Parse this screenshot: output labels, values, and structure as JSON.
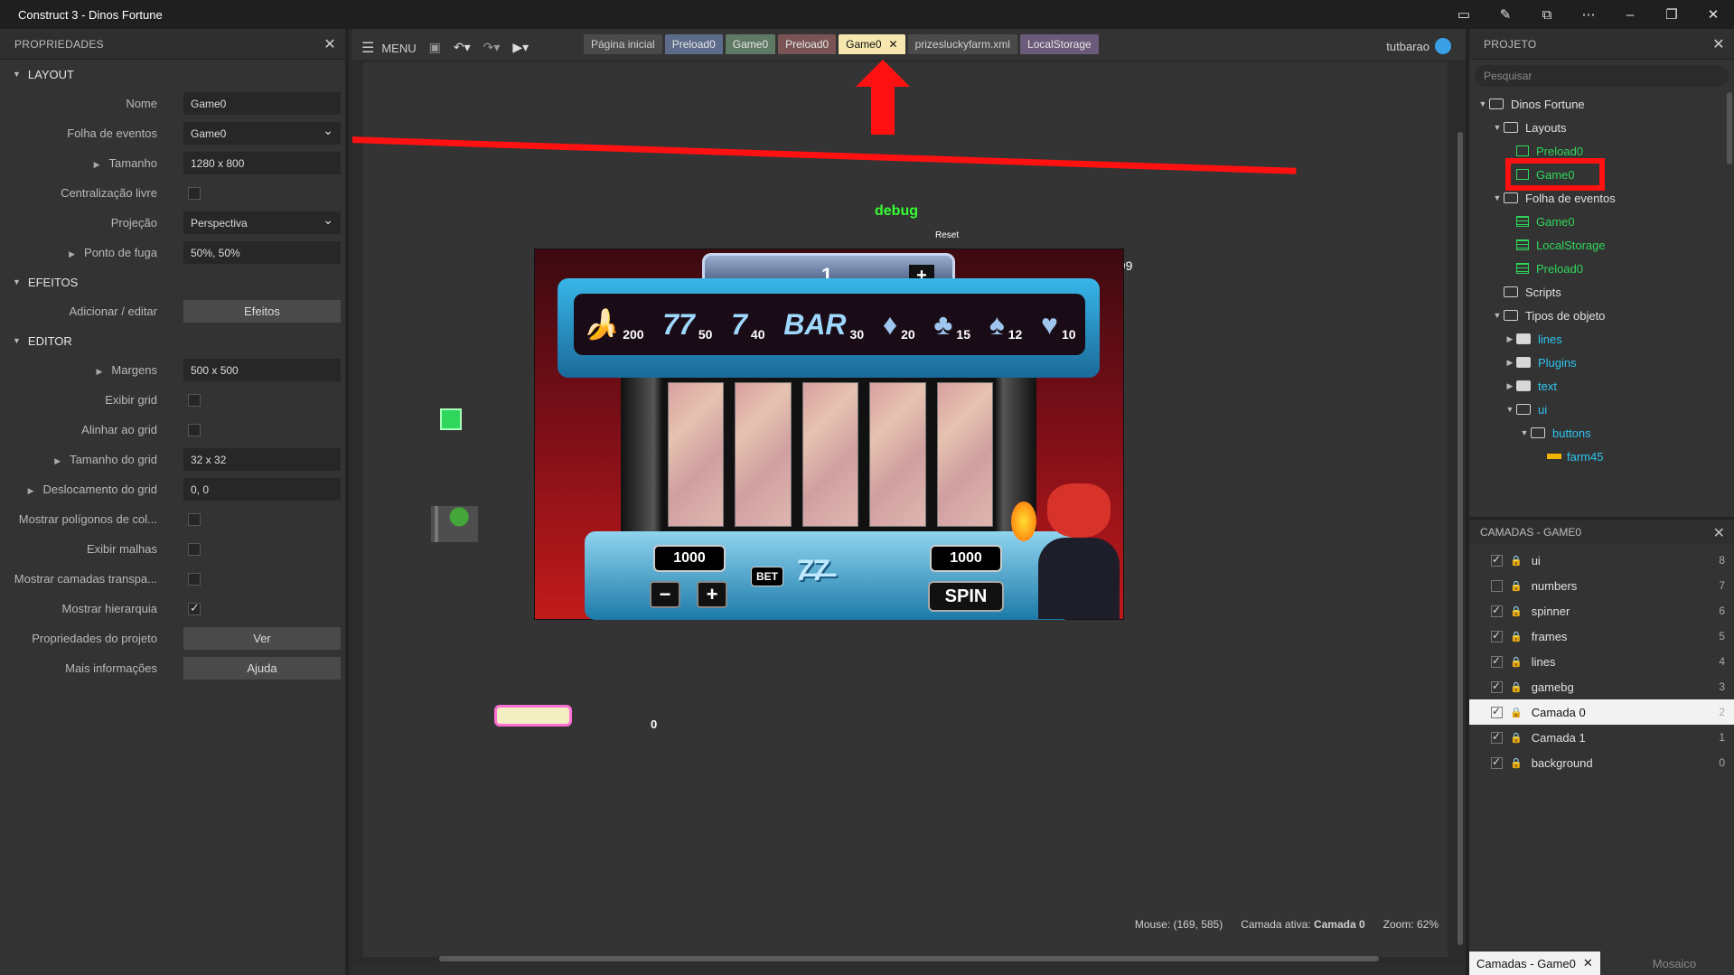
{
  "window": {
    "title": "Construct 3 - Dinos Fortune"
  },
  "titlebar_icons": [
    "clipboard-icon",
    "edit-icon",
    "frame-icon",
    "more-icon",
    "minimize-icon",
    "restore-icon",
    "close-icon"
  ],
  "properties": {
    "header": "PROPRIEDADES",
    "sections": {
      "layout": "LAYOUT",
      "effects": "EFEITOS",
      "editor": "EDITOR"
    },
    "layout": {
      "name_label": "Nome",
      "name_value": "Game0",
      "event_sheet_label": "Folha de eventos",
      "event_sheet_value": "Game0",
      "size_label": "Tamanho",
      "size_value": "1280 x 800",
      "unbounded_label": "Centralização livre",
      "projection_label": "Projeção",
      "projection_value": "Perspectiva",
      "vanishing_label": "Ponto de fuga",
      "vanishing_value": "50%, 50%"
    },
    "effects": {
      "add_label": "Adicionar / editar",
      "button": "Efeitos"
    },
    "editor": {
      "margins_label": "Margens",
      "margins_value": "500 x 500",
      "show_grid_label": "Exibir grid",
      "snap_grid_label": "Alinhar ao grid",
      "grid_size_label": "Tamanho do grid",
      "grid_size_value": "32 x 32",
      "grid_offset_label": "Deslocamento do grid",
      "grid_offset_value": "0, 0",
      "show_collision_label": "Mostrar polígonos de col...",
      "show_mesh_label": "Exibir malhas",
      "show_transparent_label": "Mostrar camadas transpa...",
      "show_hierarchy_label": "Mostrar hierarquia",
      "project_props_label": "Propriedades do projeto",
      "project_props_button": "Ver",
      "more_info_label": "Mais informações",
      "more_info_button": "Ajuda"
    }
  },
  "toolbar": {
    "menu": "MENU",
    "tabs": [
      {
        "label": "Página inicial",
        "bg": "#4a4a4a",
        "fg": "#cfcfcf"
      },
      {
        "label": "Preload0",
        "bg": "#5c6b8a",
        "fg": "#e6e6e6"
      },
      {
        "label": "Game0",
        "bg": "#5f7a64",
        "fg": "#e6e6e6"
      },
      {
        "label": "Preload0",
        "bg": "#7a5454",
        "fg": "#e6e6e6"
      },
      {
        "label": "Game0",
        "bg": "#f6e7b0",
        "fg": "#111111",
        "active": true
      },
      {
        "label": "prizesluckyfarm.xml",
        "bg": "#4a4a4a",
        "fg": "#cfcfcf"
      },
      {
        "label": "LocalStorage",
        "bg": "#6b5a7a",
        "fg": "#e6e6e6"
      }
    ],
    "user": "tutbarao"
  },
  "canvas": {
    "debug_text": "debug",
    "reset_text": "Reset",
    "counter_text": "999",
    "zero_text": "0",
    "slot": {
      "lines_value": "1",
      "paytable": [
        {
          "symbol": "banana-icon",
          "payout": "200"
        },
        {
          "symbol": "seven-seven-icon",
          "payout": "50"
        },
        {
          "symbol": "seven-icon",
          "payout": "40"
        },
        {
          "symbol": "bar-icon",
          "payout": "30"
        },
        {
          "symbol": "diamond-icon",
          "payout": "20"
        },
        {
          "symbol": "club-icon",
          "payout": "15"
        },
        {
          "symbol": "spade-icon",
          "payout": "12"
        },
        {
          "symbol": "heart-icon",
          "payout": "10"
        }
      ],
      "bet_amount": "1000",
      "bet_label": "BET",
      "credits": "1000",
      "spin_label": "SPIN"
    }
  },
  "status": {
    "mouse": "Mouse: (169, 585)",
    "layer_label": "Camada ativa:",
    "layer_value": "Camada 0",
    "zoom": "Zoom: 62%"
  },
  "project": {
    "header": "PROJETO",
    "search_placeholder": "Pesquisar",
    "tree": {
      "root": "Dinos Fortune",
      "layouts_folder": "Layouts",
      "layouts": [
        "Preload0",
        "Game0"
      ],
      "event_sheets_folder": "Folha de eventos",
      "event_sheets": [
        "Game0",
        "LocalStorage",
        "Preload0"
      ],
      "scripts": "Scripts",
      "object_types": "Tipos de objeto",
      "object_folders": [
        "lines",
        "Plugins",
        "text",
        "ui"
      ],
      "buttons_folder": "buttons",
      "farm_item": "farm45"
    }
  },
  "layers": {
    "header": "CAMADAS - GAME0",
    "items": [
      {
        "name": "ui",
        "num": "8",
        "checked": true
      },
      {
        "name": "numbers",
        "num": "7",
        "checked": false
      },
      {
        "name": "spinner",
        "num": "6",
        "checked": true
      },
      {
        "name": "frames",
        "num": "5",
        "checked": true
      },
      {
        "name": "lines",
        "num": "4",
        "checked": true
      },
      {
        "name": "gamebg",
        "num": "3",
        "checked": true
      },
      {
        "name": "Camada 0",
        "num": "2",
        "checked": true,
        "active": true
      },
      {
        "name": "Camada 1",
        "num": "1",
        "checked": true
      },
      {
        "name": "background",
        "num": "0",
        "checked": true
      }
    ]
  },
  "bottom_tabs": {
    "layers_tab": "Camadas - Game0",
    "tiles_tab": "Mosaico"
  },
  "colors": {
    "annotation_red": "#ff1111",
    "green_asset": "#2fd65b",
    "active_tab": "#f6e7b0"
  }
}
